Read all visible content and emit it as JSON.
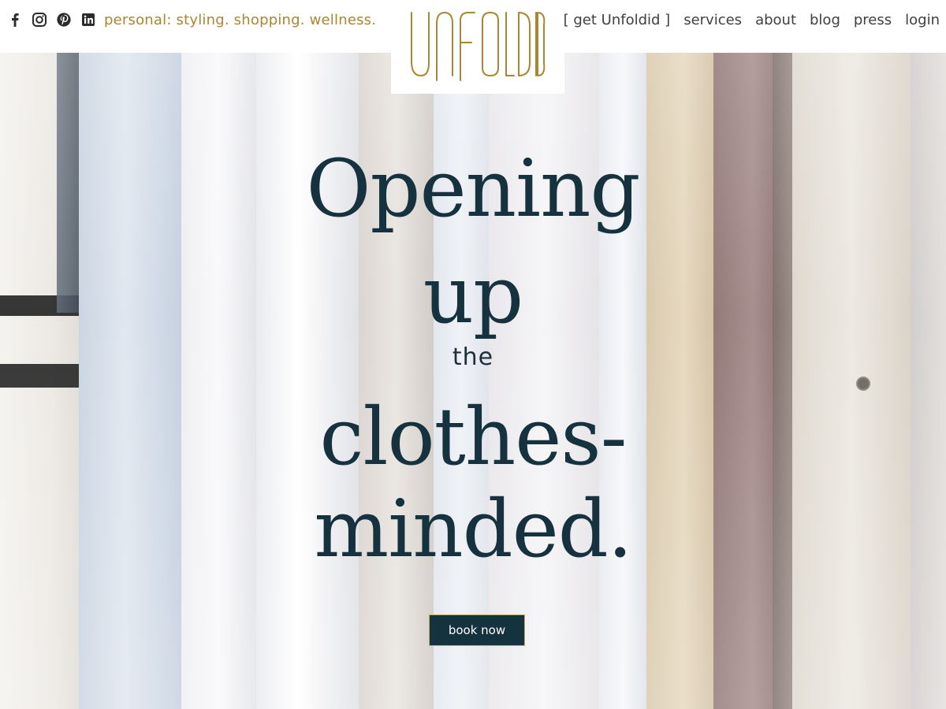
{
  "header": {
    "social": [
      {
        "icon": "facebook-icon"
      },
      {
        "icon": "instagram-icon"
      },
      {
        "icon": "pinterest-icon"
      },
      {
        "icon": "linkedin-icon"
      }
    ],
    "tagline": "personal: styling. shopping. wellness.",
    "logo_text": "Unfoldid",
    "nav": [
      {
        "label": "[ get Unfoldid ]"
      },
      {
        "label": "services"
      },
      {
        "label": "about"
      },
      {
        "label": "blog"
      },
      {
        "label": "press"
      },
      {
        "label": "login"
      }
    ]
  },
  "hero": {
    "line1": "Opening",
    "line2": "up",
    "line3": "the",
    "line4": "clothes-",
    "line5": "minded.",
    "cta_label": "book now"
  },
  "colors": {
    "accent_gold": "#a9872f",
    "headline_navy": "#16323f",
    "button_bg": "#15323f",
    "button_border": "#c7a94f"
  }
}
